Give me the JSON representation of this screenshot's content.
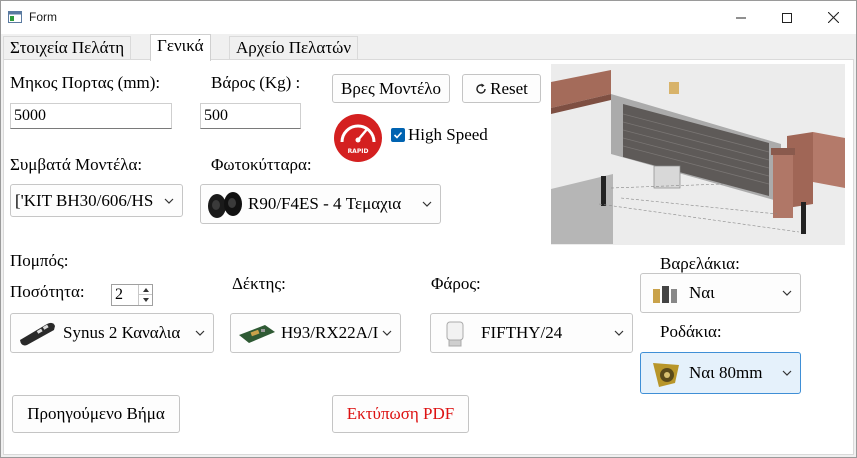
{
  "window": {
    "title": "Form"
  },
  "tabs": [
    {
      "label": "Στοιχεία Πελάτη",
      "active": false
    },
    {
      "label": "Γενικά",
      "active": true
    },
    {
      "label": "Αρχείο Πελατών",
      "active": false
    }
  ],
  "form": {
    "door_length_label": "Μηκος Πορτας (mm):",
    "door_length_value": "5000",
    "weight_label": "Βάρος (Kg) :",
    "weight_value": "500",
    "find_model_button": "Βρες Μοντέλο",
    "reset_button": "Reset",
    "rapid_badge": "RAPID",
    "high_speed_label": "High Speed",
    "high_speed_checked": true,
    "compatible_models_label": "Συμβατά Μοντέλα:",
    "compatible_models_value": "['KIT BH30/606/HS",
    "photocells_label": "Φωτοκύτταρα:",
    "photocells_value": "R90/F4ES - 4 Τεμαχια",
    "transmitter_label": "Πομπός:",
    "quantity_label": "Ποσότητα:",
    "quantity_value": "2",
    "transmitter_value": "Synus 2 Καναλια",
    "receiver_label": "Δέκτης:",
    "receiver_value": "H93/RX22A/I",
    "beacon_label": "Φάρος:",
    "beacon_value": "FIFTHY/24",
    "weights_label": "Βαρελάκια:",
    "weights_value": "Ναι",
    "wheels_label": "Ροδάκια:",
    "wheels_value": "Ναι 80mm",
    "previous_button": "Προηγούμενο Βήμα",
    "print_pdf_button": "Εκτύπωση PDF"
  },
  "colors": {
    "accent": "#0063b1",
    "pdf_text": "#dd1111",
    "rapid_badge": "#d42020",
    "selected_combo": "#e5f1fb"
  },
  "icons": {
    "reset": "refresh-icon",
    "dropdown": "chevron-down-icon"
  }
}
